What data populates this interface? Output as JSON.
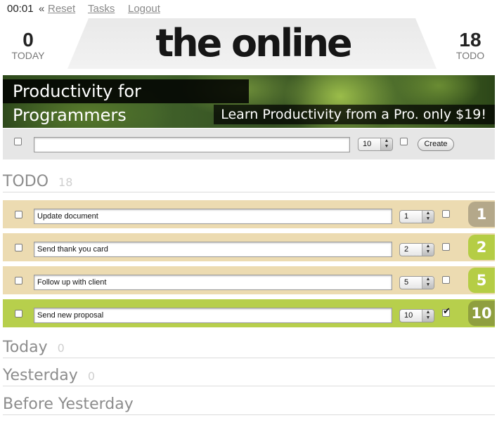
{
  "nav": {
    "timer": "00:01",
    "separator": "«",
    "reset": "Reset",
    "tasks": "Tasks",
    "logout": "Logout"
  },
  "header": {
    "logo": "the online ceo",
    "today": {
      "count": "0",
      "label": "TODAY"
    },
    "todo": {
      "count": "18",
      "label": "TODO"
    }
  },
  "banner": {
    "title": "Productivity for Programmers",
    "subtitle": "Learn Productivity from a Pro. only $19!"
  },
  "create_form": {
    "text_value": "",
    "priority": "10",
    "button_label": "Create"
  },
  "sections": {
    "todo": {
      "name": "TODO",
      "count": "18"
    },
    "today": {
      "name": "Today",
      "count": "0"
    },
    "yesterday": {
      "name": "Yesterday",
      "count": "0"
    },
    "before_yesterday": {
      "name": "Before Yesterday"
    }
  },
  "tasks": [
    {
      "title": "Update document",
      "priority": "1",
      "checked": false,
      "badge": "1",
      "badge_color": "#b4a88a"
    },
    {
      "title": "Send thank you card",
      "priority": "2",
      "checked": false,
      "badge": "2",
      "badge_color": "#b5cd45"
    },
    {
      "title": "Follow up with client",
      "priority": "5",
      "checked": false,
      "badge": "5",
      "badge_color": "#b5cd45"
    },
    {
      "title": "Send new proposal",
      "priority": "10",
      "checked": true,
      "badge": "10",
      "badge_color": "#8f9f3f"
    }
  ],
  "colors": {
    "task_bg": "#ecdbb1",
    "task_highlight_bg": "#b7cf4c"
  }
}
